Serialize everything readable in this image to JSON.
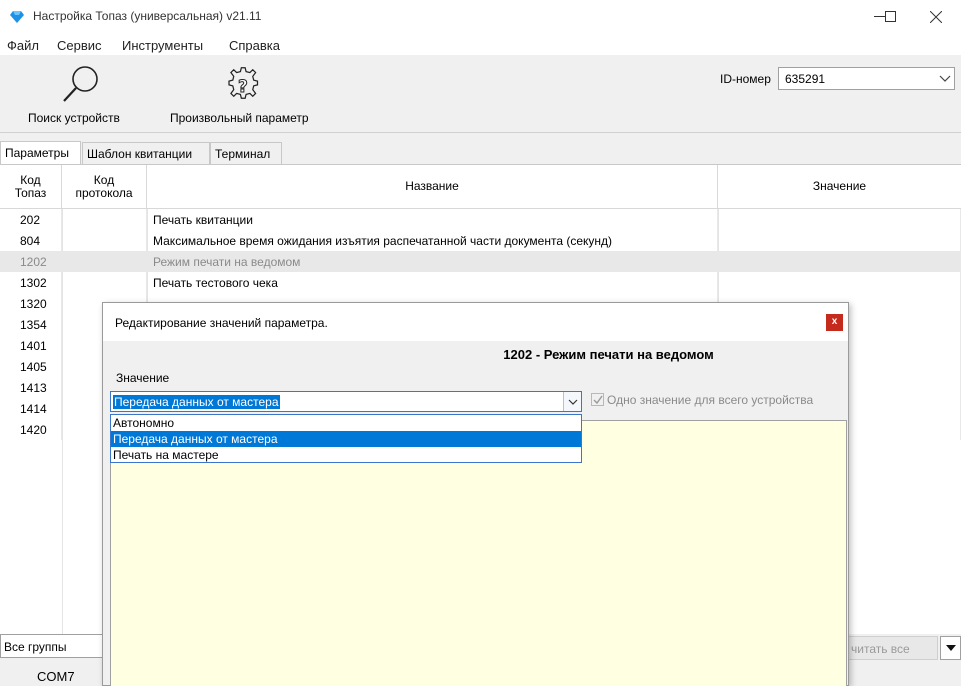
{
  "window": {
    "title": "Настройка Топаз (универсальная) v21.11",
    "min_glyph": "—",
    "max_glyph": "☐",
    "close_glyph": "✕",
    "app_icon": "diamond-icon",
    "app_icon_color": "#1e90e6"
  },
  "menu": [
    "Файл",
    "Сервис",
    "Инструменты",
    "Справка"
  ],
  "toolbar": {
    "search_label": "Поиск устройств",
    "custom_param_label": "Произвольный параметр",
    "id_label": "ID-номер",
    "id_value": "635291"
  },
  "tabs": [
    "Параметры",
    "Шаблон квитанции",
    "Терминал"
  ],
  "grid": {
    "headers": [
      "Код\nТопаз",
      "Код\nпротокола",
      "Название",
      "Значение"
    ],
    "rows": [
      {
        "code": "202",
        "proto": "",
        "name": "Печать квитанции",
        "value": ""
      },
      {
        "code": "804",
        "proto": "",
        "name": "Максимальное время ожидания изъятия распечатанной части документа (секунд)",
        "value": ""
      },
      {
        "code": "1202",
        "proto": "",
        "name": "Режим печати на ведомом",
        "value": "",
        "selected": true
      },
      {
        "code": "1302",
        "proto": "",
        "name": "Печать тестового чека",
        "value": ""
      },
      {
        "code": "1320",
        "proto": "",
        "name": "",
        "value": ""
      },
      {
        "code": "1354",
        "proto": "",
        "name": "",
        "value": ""
      },
      {
        "code": "1401",
        "proto": "",
        "name": "",
        "value": ""
      },
      {
        "code": "1405",
        "proto": "",
        "name": "",
        "value": ""
      },
      {
        "code": "1413",
        "proto": "",
        "name": "",
        "value": ""
      },
      {
        "code": "1414",
        "proto": "",
        "name": "",
        "value": ""
      },
      {
        "code": "1420",
        "proto": "",
        "name": "",
        "value": ""
      }
    ]
  },
  "bottom": {
    "group_filter": "Все группы",
    "read_all": "читать все",
    "port": "COM7"
  },
  "dialog": {
    "title": "Редактирование значений параметра.",
    "close": "x",
    "heading": "1202 - Режим печати на ведомом",
    "value_label": "Значение",
    "selected_value": "Передача данных от мастера",
    "single_value_label": "Одно значение для всего устройства",
    "options": [
      "Автономно",
      "Передача данных от мастера",
      "Печать на мастере"
    ],
    "highlighted_option": 1
  },
  "colors": {
    "accent": "#0078d7",
    "close_red": "#c42b1c",
    "memo_bg": "#ffffe1"
  }
}
